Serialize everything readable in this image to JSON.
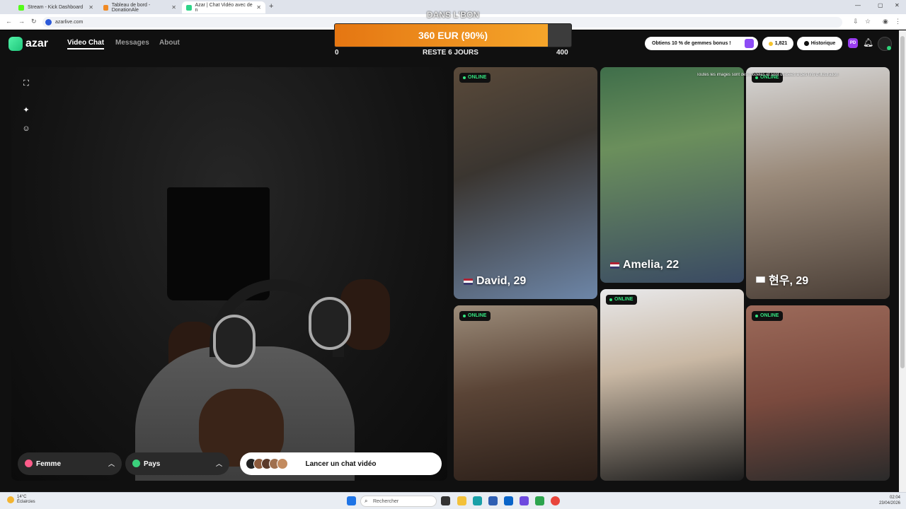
{
  "browser": {
    "tabs": [
      {
        "title": "Stream - Kick Dashboard",
        "active": false
      },
      {
        "title": "Tableau de bord - DonationAle",
        "active": false
      },
      {
        "title": "Azar | Chat Vidéo avec de n",
        "active": true
      }
    ],
    "url": "azarlive.com"
  },
  "app": {
    "logo": "azar",
    "nav": [
      {
        "label": "Video Chat",
        "active": true
      },
      {
        "label": "Messages",
        "active": false
      },
      {
        "label": "About",
        "active": false
      }
    ],
    "promo": "Obtiens 10 % de gemmes bonus !",
    "gems": "1,821",
    "history": "Historique",
    "profile_badge": "PD"
  },
  "donation_goal": {
    "title": "DANS L'BON",
    "amount": "360 EUR (90%)",
    "progress": 0.9,
    "min": "0",
    "max": "400",
    "remaining": "RESTE 6 JOURS",
    "colors": {
      "fill_start": "#e57612",
      "fill_end": "#f5a52a",
      "track": "#3c3c3c"
    }
  },
  "controls": {
    "gender": "Femme",
    "country": "Pays",
    "start": "Lancer un chat vidéo"
  },
  "disclaimer": "Toutes les images sont des modèles et sont utilisées à des fins d'illustration",
  "profiles": [
    {
      "name": "David, 29",
      "status": "ONLINE",
      "flag": "us"
    },
    {
      "name": "Amelia, 22",
      "status": "",
      "flag": "us"
    },
    {
      "name": "현우, 29",
      "status": "ONLINE",
      "flag": "kr"
    },
    {
      "name": "",
      "status": "ONLINE",
      "flag": ""
    },
    {
      "name": "",
      "status": "ONLINE",
      "flag": ""
    },
    {
      "name": "",
      "status": "ONLINE",
      "flag": ""
    }
  ],
  "taskbar": {
    "weather_temp": "14°C",
    "weather_desc": "Éclaircies",
    "search_placeholder": "Rechercher",
    "time": "02:04",
    "date": "23/04/2026"
  }
}
